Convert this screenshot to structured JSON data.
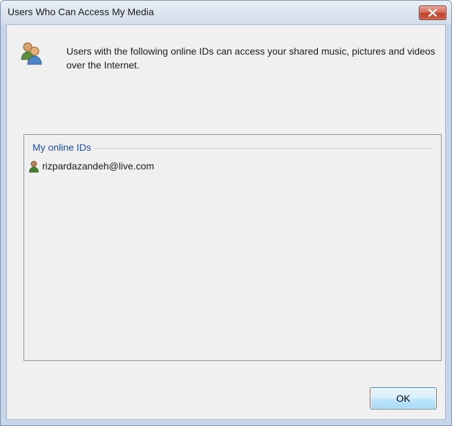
{
  "window": {
    "title": "Users Who Can Access My Media"
  },
  "title_bar": {
    "close_icon": "close-icon"
  },
  "header": {
    "icon": "users-icon",
    "message": "Users with the following online IDs can access your shared music, pictures and videos over the Internet."
  },
  "online_ids": {
    "group_title": "My online IDs",
    "items": [
      {
        "icon": "user-icon",
        "label": "rizpardazandeh@live.com"
      }
    ]
  },
  "buttons": {
    "ok_label": "OK"
  }
}
